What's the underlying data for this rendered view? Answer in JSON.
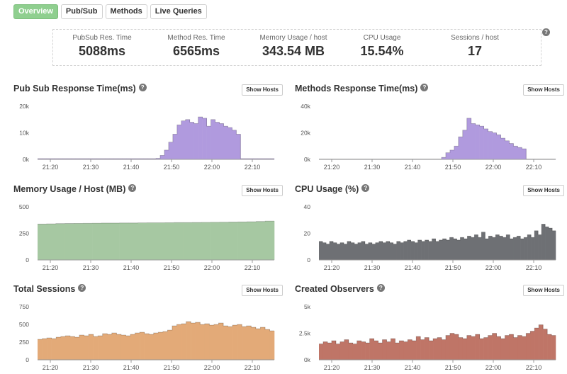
{
  "tabs": [
    {
      "label": "Overview",
      "active": true
    },
    {
      "label": "Pub/Sub",
      "active": false
    },
    {
      "label": "Methods",
      "active": false
    },
    {
      "label": "Live Queries",
      "active": false
    }
  ],
  "stats": [
    {
      "label": "PubSub Res. Time",
      "value": "5088ms"
    },
    {
      "label": "Method Res. Time",
      "value": "6565ms"
    },
    {
      "label": "Memory Usage / host",
      "value": "343.54 MB"
    },
    {
      "label": "CPU Usage",
      "value": "15.54%"
    },
    {
      "label": "Sessions / host",
      "value": "17"
    }
  ],
  "help_icon": "question-icon",
  "show_hosts_label": "Show Hosts",
  "colors": {
    "purple": "#b09ade",
    "green": "#a6c8a2",
    "gray": "#6e7074",
    "orange": "#e3aa78",
    "red": "#bf7567",
    "tab_active": "#8fcf8f"
  },
  "panels": [
    {
      "title": "Pub Sub Response Time(ms)",
      "chart_data": {
        "type": "area",
        "color": "#b09ade",
        "x_ticks": [
          "21:20",
          "21:30",
          "21:40",
          "21:50",
          "22:00",
          "22:10"
        ],
        "y_ticks": [
          "0k",
          "10k",
          "20k"
        ],
        "ylim": [
          0,
          20000
        ],
        "values": [
          300,
          300,
          300,
          300,
          300,
          300,
          300,
          300,
          300,
          300,
          300,
          300,
          300,
          300,
          300,
          300,
          300,
          300,
          300,
          300,
          300,
          300,
          300,
          300,
          300,
          300,
          300,
          300,
          400,
          1500,
          3500,
          6500,
          9500,
          13000,
          14500,
          15000,
          14000,
          13500,
          16000,
          15500,
          12500,
          15000,
          14000,
          13500,
          12500,
          12000,
          11000,
          9500,
          300,
          300,
          300,
          300,
          300,
          300,
          300,
          300
        ]
      }
    },
    {
      "title": "Methods Response Time(ms)",
      "chart_data": {
        "type": "area",
        "color": "#b09ade",
        "x_ticks": [
          "21:20",
          "21:30",
          "21:40",
          "21:50",
          "22:00",
          "22:10"
        ],
        "y_ticks": [
          "0k",
          "20k",
          "40k"
        ],
        "ylim": [
          0,
          40000
        ],
        "values": [
          300,
          300,
          300,
          300,
          300,
          300,
          300,
          300,
          300,
          300,
          300,
          300,
          300,
          300,
          300,
          300,
          300,
          300,
          300,
          300,
          300,
          300,
          300,
          300,
          300,
          300,
          300,
          300,
          300,
          1500,
          5000,
          7000,
          10000,
          17000,
          22000,
          31000,
          27000,
          26000,
          25000,
          23000,
          21000,
          20000,
          18500,
          16000,
          14000,
          12000,
          10000,
          9000,
          8000,
          300,
          300,
          300,
          300,
          300,
          300,
          300
        ]
      }
    },
    {
      "title": "Memory Usage / Host (MB)",
      "chart_data": {
        "type": "area",
        "color": "#a6c8a2",
        "x_ticks": [
          "21:20",
          "21:30",
          "21:40",
          "21:50",
          "22:00",
          "22:10"
        ],
        "y_ticks": [
          "0",
          "250",
          "500"
        ],
        "ylim": [
          0,
          500
        ],
        "values": [
          338,
          340,
          342,
          343,
          344,
          345,
          346,
          347,
          347,
          348,
          348,
          349,
          350,
          350,
          351,
          352,
          352,
          353,
          354,
          355,
          356,
          357,
          358,
          360,
          362,
          366
        ]
      }
    },
    {
      "title": "CPU Usage (%)",
      "chart_data": {
        "type": "area",
        "color": "#6e7074",
        "x_ticks": [
          "21:20",
          "21:30",
          "21:40",
          "21:50",
          "22:00",
          "22:10"
        ],
        "y_ticks": [
          "0",
          "20",
          "40"
        ],
        "ylim": [
          0,
          40
        ],
        "values": [
          14,
          13,
          12,
          14,
          13,
          12,
          13,
          12,
          14,
          13,
          12,
          13,
          14,
          12,
          13,
          12,
          13,
          14,
          13,
          14,
          13,
          12,
          14,
          13,
          14,
          15,
          14,
          13,
          15,
          14,
          15,
          14,
          16,
          14,
          15,
          16,
          15,
          17,
          16,
          15,
          17,
          16,
          18,
          17,
          19,
          17,
          21,
          16,
          18,
          17,
          19,
          18,
          17,
          19,
          16,
          17,
          18,
          16,
          17,
          19,
          17,
          22,
          19,
          27,
          25,
          24,
          22
        ]
      }
    },
    {
      "title": "Total Sessions",
      "chart_data": {
        "type": "area",
        "color": "#e3aa78",
        "x_ticks": [
          "21:20",
          "21:30",
          "21:40",
          "21:50",
          "22:00",
          "22:10"
        ],
        "y_ticks": [
          "0",
          "250",
          "500",
          "750"
        ],
        "ylim": [
          0,
          750
        ],
        "values": [
          290,
          300,
          310,
          300,
          320,
          330,
          340,
          330,
          320,
          350,
          340,
          360,
          330,
          340,
          370,
          360,
          380,
          360,
          350,
          340,
          360,
          380,
          390,
          370,
          360,
          380,
          390,
          400,
          420,
          480,
          500,
          510,
          540,
          520,
          530,
          500,
          510,
          490,
          500,
          520,
          480,
          470,
          490,
          500,
          470,
          480,
          460,
          440,
          460,
          430,
          410
        ]
      }
    },
    {
      "title": "Created Observers",
      "chart_data": {
        "type": "area",
        "color": "#bf7567",
        "x_ticks": [
          "21:20",
          "21:30",
          "21:40",
          "21:50",
          "22:00",
          "22:10"
        ],
        "y_ticks": [
          "0k",
          "2.5k",
          "5k"
        ],
        "ylim": [
          0,
          5000
        ],
        "values": [
          1500,
          1700,
          1600,
          1800,
          1500,
          1700,
          1900,
          1600,
          1500,
          1800,
          1700,
          1600,
          2000,
          1800,
          1600,
          1900,
          1700,
          2000,
          1600,
          1800,
          1700,
          1900,
          1800,
          2200,
          1900,
          2100,
          1800,
          2000,
          2100,
          1900,
          2300,
          2500,
          2400,
          2100,
          2000,
          2300,
          2200,
          2400,
          2000,
          2100,
          2300,
          2500,
          2200,
          2000,
          2300,
          2400,
          2100,
          2300,
          2200,
          2500,
          2700,
          3000,
          3300,
          2900,
          2400,
          2300
        ]
      }
    }
  ]
}
